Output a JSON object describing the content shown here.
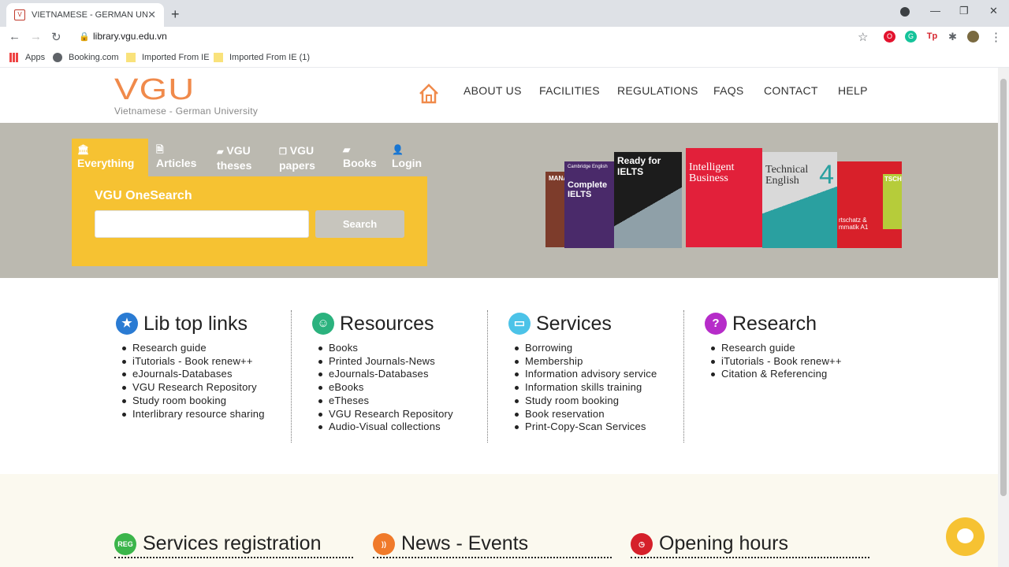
{
  "browser": {
    "tab_title": "VIETNAMESE - GERMAN UNIVE",
    "tab_close": "✕",
    "new_tab": "+",
    "url": "library.vgu.edu.vn",
    "bookmarks": [
      "Apps",
      "Booking.com",
      "Imported From IE",
      "Imported From IE (1)"
    ]
  },
  "header": {
    "logo_main": "VGU",
    "logo_sub": "Vietnamese - German University",
    "menu": [
      "ABOUT US",
      "FACILITIES",
      "REGULATIONS",
      "FAQS",
      "CONTACT",
      "HELP"
    ]
  },
  "search": {
    "tabs": [
      {
        "line1": "",
        "line2": "Everything"
      },
      {
        "line1": "",
        "line2": "Articles"
      },
      {
        "line1": "VGU",
        "line2": "theses"
      },
      {
        "line1": "VGU",
        "line2": "papers"
      },
      {
        "line1": "",
        "line2": "Books"
      },
      {
        "line1": "",
        "line2": "Login"
      }
    ],
    "label": "VGU OneSearch",
    "input_value": "",
    "button": "Search"
  },
  "books": {
    "b1": "MANA",
    "b2_title": "Complete IELTS",
    "b2_top": "Cambridge English",
    "b3_title": "Ready for IELTS",
    "b4_title": "Intelligent Business",
    "b5_title": "Technical English",
    "b5_num": "4",
    "b6_a": "TSCH",
    "b6_b": "rtschatz & mmatik A1"
  },
  "columns": [
    {
      "title": "Lib top links",
      "items": [
        "Research guide",
        "iTutorials - Book renew++",
        "eJournals-Databases",
        "VGU Research Repository",
        "Study room booking",
        "Interlibrary resource sharing"
      ]
    },
    {
      "title": "Resources",
      "items": [
        "Books",
        "Printed Journals-News",
        "eJournals-Databases",
        "eBooks",
        "eTheses",
        "VGU Research Repository",
        "Audio-Visual collections"
      ]
    },
    {
      "title": "Services",
      "items": [
        "Borrowing",
        "Membership",
        "Information advisory service",
        "Information skills training",
        "Study room booking",
        "Book reservation",
        "Print-Copy-Scan Services"
      ]
    },
    {
      "title": "Research",
      "items": [
        "Research guide",
        "iTutorials - Book renew++",
        "Citation & Referencing"
      ]
    }
  ],
  "sections": [
    "Services registration",
    "News - Events",
    "Opening hours"
  ],
  "colors": {
    "accent": "#f6c232",
    "logo": "#f08a4b",
    "hero_bg": "#bbb9b0"
  }
}
